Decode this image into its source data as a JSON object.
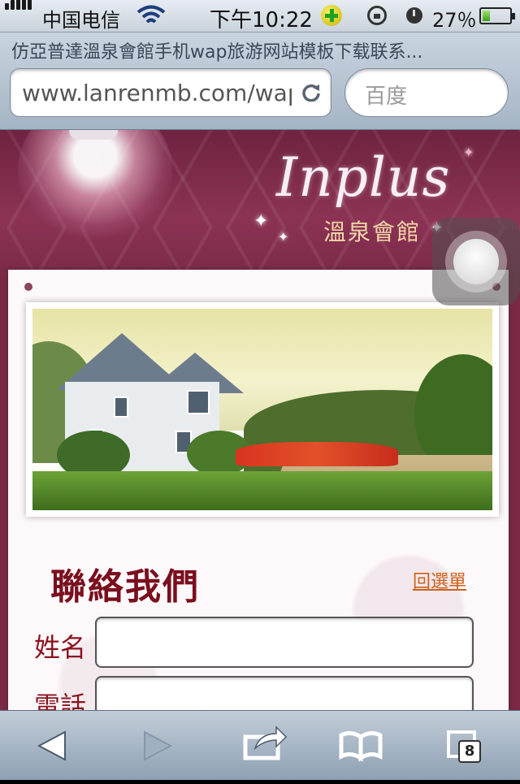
{
  "status_bar": {
    "carrier": "中国电信",
    "time": "下午10:22",
    "battery_percent": "27％",
    "battery_level": 0.27
  },
  "browser": {
    "page_title": "仿亞普達溫泉會館手机wap旅游网站模板下载联系...",
    "url": "www.lanrenmb.com/wap",
    "search_placeholder": "百度",
    "tab_count": "8"
  },
  "site": {
    "logo_script": "Inplus",
    "logo_sub": "溫泉會館",
    "section_title": "聯絡我們",
    "back_link": "回選單",
    "form": {
      "name_label": "姓名",
      "name_value": "",
      "phone_label": "電話",
      "phone_value": ""
    }
  },
  "icons": [
    "signal-bars-icon",
    "wifi-icon",
    "location-plus-icon",
    "rotation-lock-icon",
    "alarm-icon",
    "battery-icon",
    "reload-icon",
    "back-arrow-icon",
    "forward-arrow-icon",
    "share-icon",
    "bookmarks-icon",
    "tabs-icon"
  ]
}
